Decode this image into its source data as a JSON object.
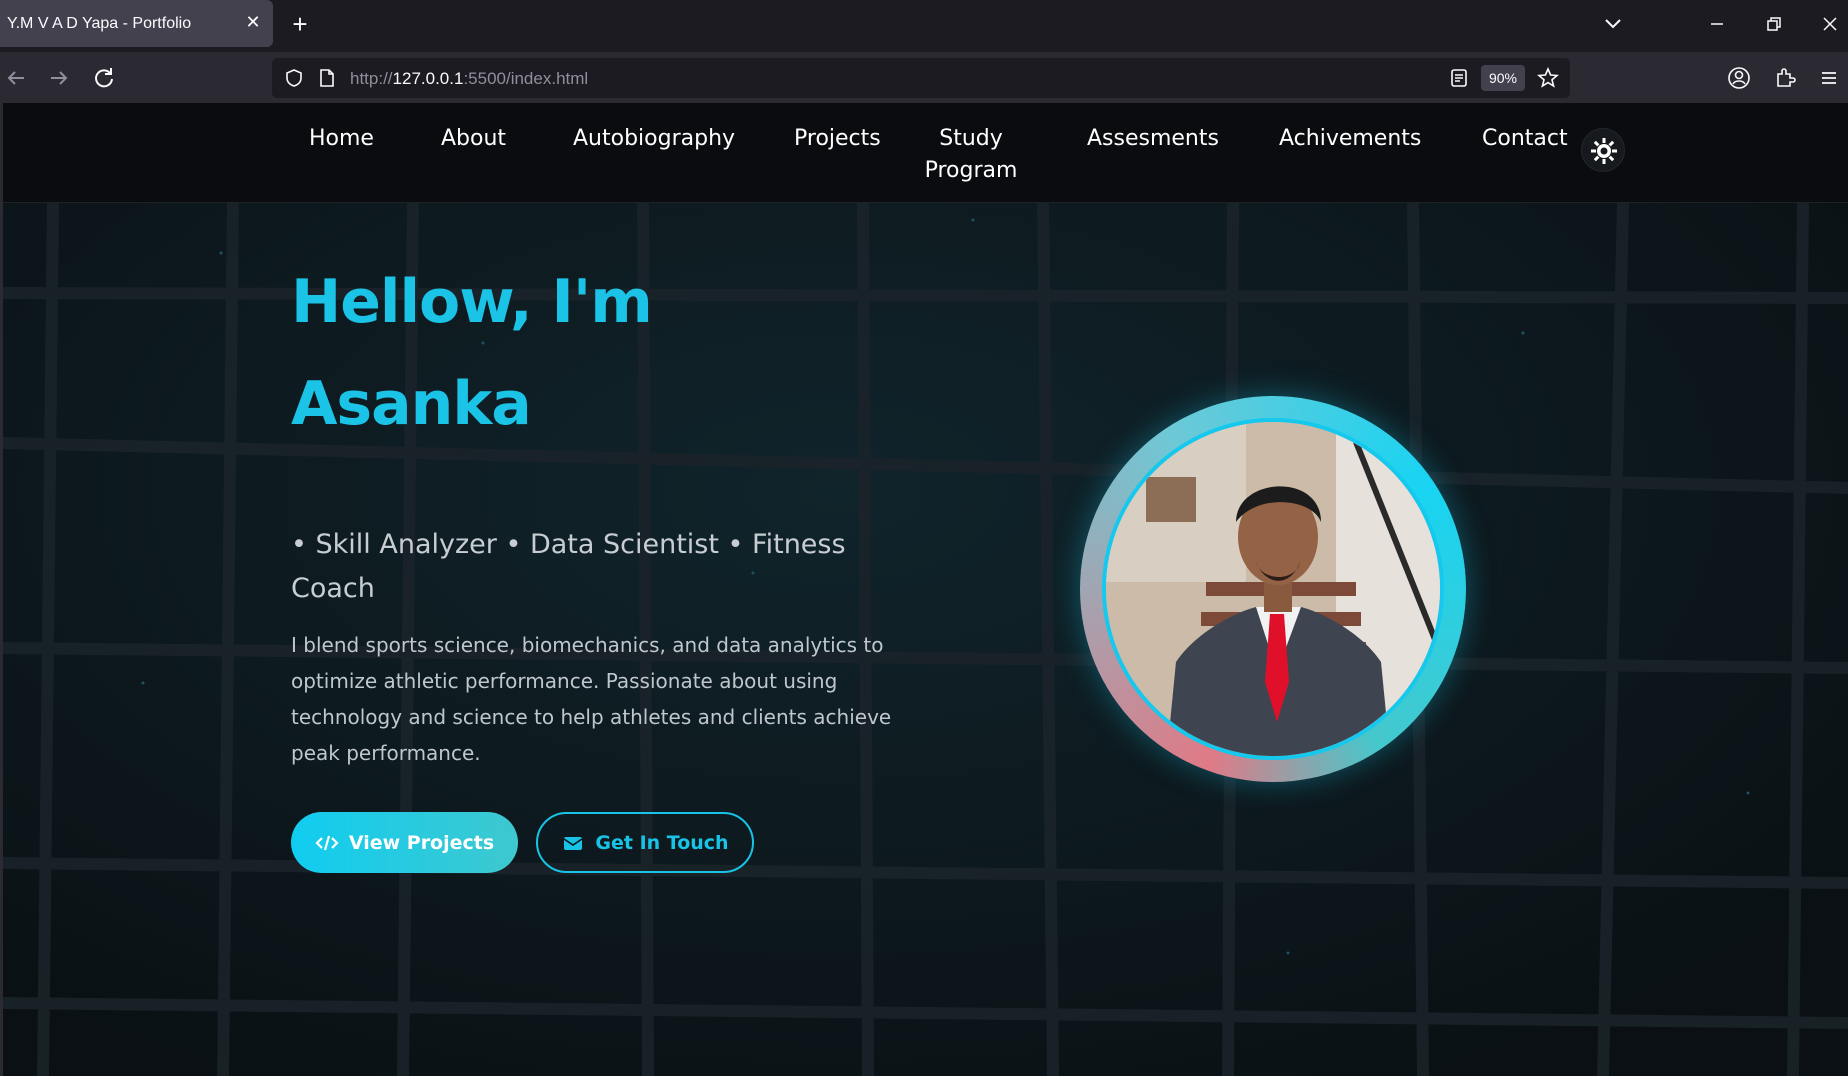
{
  "browser": {
    "tab_title": "Y.M V A D Yapa - Portfolio",
    "tab_close": "✕",
    "new_tab": "+",
    "url_scheme": "http://",
    "url_host": "127.0.0.1",
    "url_rest": ":5500/index.html",
    "zoom": "90%"
  },
  "nav": {
    "items": [
      "Home",
      "About",
      "Autobiography",
      "Projects",
      "Study Program",
      "Assesments",
      "Achivements",
      "Contact"
    ]
  },
  "hero": {
    "title_line1": "Hellow, I'm",
    "title_line2": "Asanka",
    "roles": "• Skill Analyzer • Data Scientist • Fitness Coach",
    "description": "I blend sports science, biomechanics, and data analytics to optimize athletic performance. Passionate about using technology and science to help athletes and clients achieve peak performance.",
    "primary_button": "View Projects",
    "secondary_button": "Get In Touch"
  },
  "colors": {
    "accent": "#1bc4e6",
    "background": "#0e1519",
    "nav_background": "#0b0c0f"
  },
  "icons": {
    "primary_button_icon": "code-icon",
    "secondary_button_icon": "envelope-icon",
    "theme_toggle_icon": "sun-icon"
  }
}
